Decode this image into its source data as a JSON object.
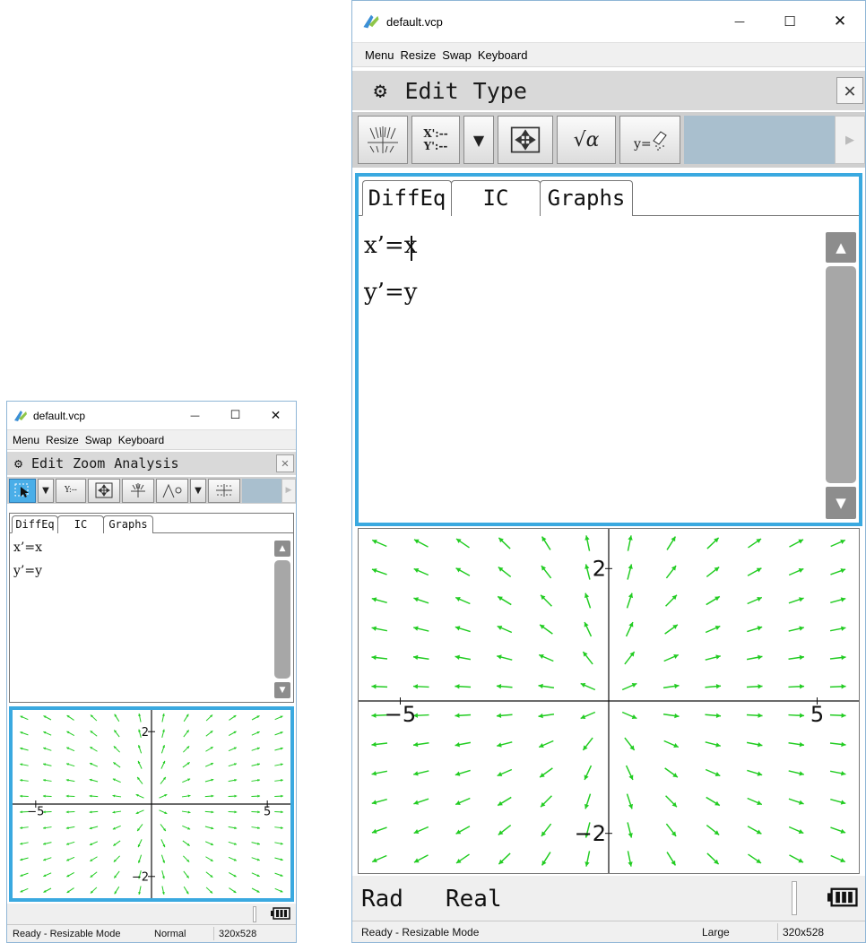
{
  "small": {
    "title": "default.vcp",
    "window_controls": {
      "minimize": "—",
      "maximize": "☐",
      "close": "✕"
    },
    "menu": [
      "Menu",
      "Resize",
      "Swap",
      "Keyboard"
    ],
    "calc_menu": [
      "Edit",
      "Zoom",
      "Analysis"
    ],
    "toolbar_icons": [
      "select-arrow",
      "dropdown",
      "y-equals",
      "zoom-fit",
      "slope-field",
      "trace-graph",
      "dropdown",
      "grid-dots",
      "scroll-right"
    ],
    "tabs": [
      "DiffEq",
      "IC",
      "Graphs"
    ],
    "equations": [
      "x’=x",
      "y’=y"
    ],
    "axis_labels": {
      "top": "2",
      "bottom": "−2",
      "left": "−5",
      "right": "5"
    },
    "status": {
      "ready": "Ready - Resizable Mode",
      "size_mode": "Normal",
      "resolution": "320x528"
    }
  },
  "large": {
    "title": "default.vcp",
    "window_controls": {
      "minimize": "—",
      "maximize": "☐",
      "close": "✕"
    },
    "menu": [
      "Menu",
      "Resize",
      "Swap",
      "Keyboard"
    ],
    "calc_menu": [
      "Edit",
      "Type"
    ],
    "toolbar_icons": [
      "slope-field",
      "x-y-prime",
      "dropdown",
      "zoom-fit",
      "sqrt-alpha",
      "y-erase",
      "scroll-right"
    ],
    "tabs": [
      "DiffEq",
      "IC",
      "Graphs"
    ],
    "equations": [
      "x’=x",
      "y’=y"
    ],
    "axis_labels": {
      "top": "2",
      "bottom": "−2",
      "left": "−5",
      "right": "5"
    },
    "mode": {
      "angle": "Rad",
      "number": "Real"
    },
    "status": {
      "ready": "Ready - Resizable Mode",
      "size_mode": "Large",
      "resolution": "320x528"
    }
  },
  "colors": {
    "accent": "#3aa9e0",
    "field_arrows": "#22cc22"
  }
}
